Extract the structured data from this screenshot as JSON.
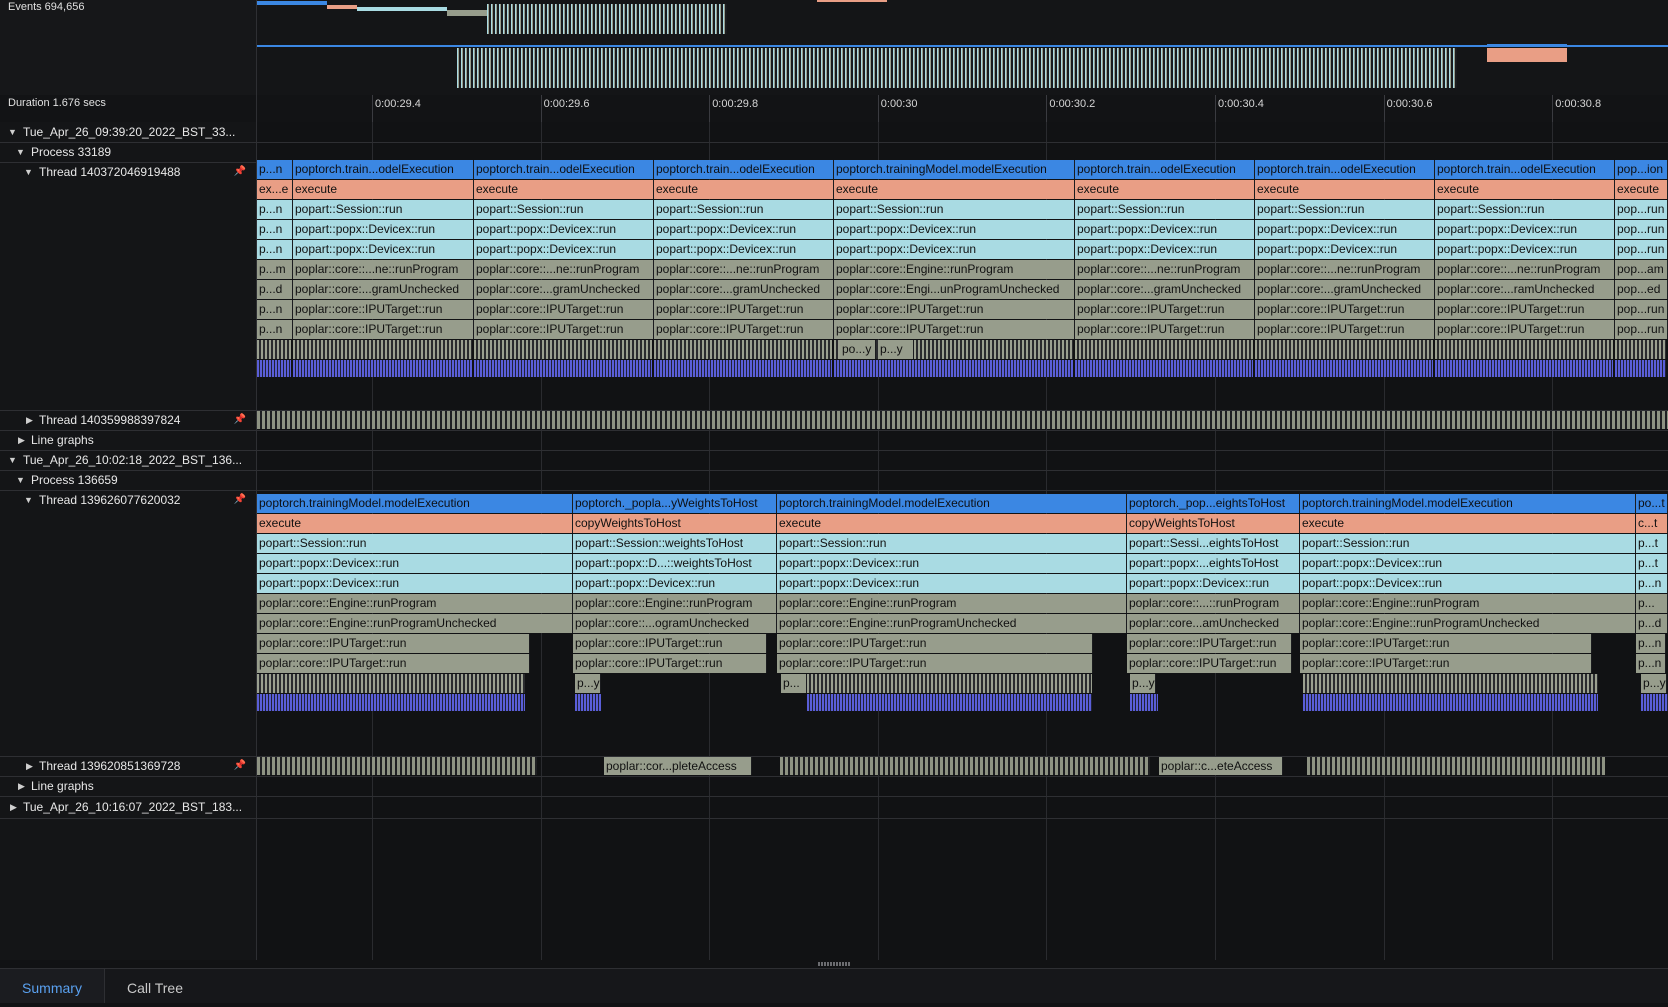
{
  "overview": {
    "events_label": "Events 694,656",
    "duration_label": "Duration 1.676 secs"
  },
  "ruler": {
    "ticks": [
      "0:00:29.4",
      "0:00:29.6",
      "0:00:29.8",
      "0:00:30",
      "0:00:30.2",
      "0:00:30.4",
      "0:00:30.6",
      "0:00:30.8"
    ]
  },
  "tree": {
    "session1": "Tue_Apr_26_09:39:20_2022_BST_33...",
    "process1": "Process 33189",
    "thread1": "Thread 140372046919488",
    "thread2": "Thread 140359988397824",
    "linegraphs1": "Line graphs",
    "session2": "Tue_Apr_26_10:02:18_2022_BST_136...",
    "process2": "Process 136659",
    "thread3": "Thread 139626077620032",
    "thread4": "Thread 139620851369728",
    "linegraphs2": "Line graphs",
    "session3": "Tue_Apr_26_10:16:07_2022_BST_183..."
  },
  "icons": {
    "expanded": "▼",
    "collapsed": "▶",
    "pin": "📌"
  },
  "colors": {
    "model_execution": "#3b87e3",
    "execute": "#e99e85",
    "popart": "#a9dbe3",
    "poplar": "#979d8c",
    "accent_tab": "#5aa1f0"
  },
  "tracks": {
    "t1": {
      "row0": [
        "p...n",
        "poptorch.train...odelExecution",
        "poptorch.train...odelExecution",
        "poptorch.train...odelExecution",
        "poptorch.trainingModel.modelExecution",
        "poptorch.train...odelExecution",
        "poptorch.train...odelExecution",
        "poptorch.train...odelExecution",
        "pop...ion"
      ],
      "row1": [
        "ex...e",
        "execute",
        "execute",
        "execute",
        "execute",
        "execute",
        "execute",
        "execute",
        "execute"
      ],
      "row2": [
        "p...n",
        "popart::Session::run",
        "popart::Session::run",
        "popart::Session::run",
        "popart::Session::run",
        "popart::Session::run",
        "popart::Session::run",
        "popart::Session::run",
        "pop...run"
      ],
      "row3": [
        "p...n",
        "popart::popx::Devicex::run",
        "popart::popx::Devicex::run",
        "popart::popx::Devicex::run",
        "popart::popx::Devicex::run",
        "popart::popx::Devicex::run",
        "popart::popx::Devicex::run",
        "popart::popx::Devicex::run",
        "pop...run"
      ],
      "row4": [
        "p...n",
        "popart::popx::Devicex::run",
        "popart::popx::Devicex::run",
        "popart::popx::Devicex::run",
        "popart::popx::Devicex::run",
        "popart::popx::Devicex::run",
        "popart::popx::Devicex::run",
        "popart::popx::Devicex::run",
        "pop...run"
      ],
      "row5": [
        "p...m",
        "poplar::core::...ne::runProgram",
        "poplar::core::...ne::runProgram",
        "poplar::core::...ne::runProgram",
        "poplar::core::Engine::runProgram",
        "poplar::core::...ne::runProgram",
        "poplar::core::...ne::runProgram",
        "poplar::core::...ne::runProgram",
        "pop...am"
      ],
      "row6": [
        "p...d",
        "poplar::core:...gramUnchecked",
        "poplar::core:...gramUnchecked",
        "poplar::core:...gramUnchecked",
        "poplar::core::Engi...unProgramUnchecked",
        "poplar::core:...gramUnchecked",
        "poplar::core:...gramUnchecked",
        "poplar::core:...ramUnchecked",
        "pop...ed"
      ],
      "row7": [
        "p...n",
        "poplar::core::IPUTarget::run",
        "poplar::core::IPUTarget::run",
        "poplar::core::IPUTarget::run",
        "poplar::core::IPUTarget::run",
        "poplar::core::IPUTarget::run",
        "poplar::core::IPUTarget::run",
        "poplar::core::IPUTarget::run",
        "pop...run"
      ],
      "row8": [
        "p...n",
        "poplar::core::IPUTarget::run",
        "poplar::core::IPUTarget::run",
        "poplar::core::IPUTarget::run",
        "poplar::core::IPUTarget::run",
        "poplar::core::IPUTarget::run",
        "poplar::core::IPUTarget::run",
        "poplar::core::IPUTarget::run",
        "pop...run"
      ],
      "small": [
        "po...y",
        "p...y"
      ]
    },
    "t3": {
      "row0": [
        "poptorch.trainingModel.modelExecution",
        "poptorch._popla...yWeightsToHost",
        "poptorch.trainingModel.modelExecution",
        "poptorch._pop...eightsToHost",
        "poptorch.trainingModel.modelExecution",
        "po...t"
      ],
      "row1": [
        "execute",
        "copyWeightsToHost",
        "execute",
        "copyWeightsToHost",
        "execute",
        "c...t"
      ],
      "row2": [
        "popart::Session::run",
        "popart::Session::weightsToHost",
        "popart::Session::run",
        "popart::Sessi...eightsToHost",
        "popart::Session::run",
        "p...t"
      ],
      "row3": [
        "popart::popx::Devicex::run",
        "popart::popx::D...::weightsToHost",
        "popart::popx::Devicex::run",
        "popart::popx:...eightsToHost",
        "popart::popx::Devicex::run",
        "p...t"
      ],
      "row4": [
        "popart::popx::Devicex::run",
        "popart::popx::Devicex::run",
        "popart::popx::Devicex::run",
        "popart::popx::Devicex::run",
        "popart::popx::Devicex::run",
        "p...n"
      ],
      "row5": [
        "poplar::core::Engine::runProgram",
        "poplar::core::Engine::runProgram",
        "poplar::core::Engine::runProgram",
        "poplar::core::...::runProgram",
        "poplar::core::Engine::runProgram",
        "p..."
      ],
      "row6": [
        "poplar::core::Engine::runProgramUnchecked",
        "poplar::core::...ogramUnchecked",
        "poplar::core::Engine::runProgramUnchecked",
        "poplar::core...amUnchecked",
        "poplar::core::Engine::runProgramUnchecked",
        "p...d"
      ],
      "row7": [
        "poplar::core::IPUTarget::run",
        "poplar::core::IPUTarget::run",
        "poplar::core::IPUTarget::run",
        "poplar::core::IPUTarget::run",
        "poplar::core::IPUTarget::run",
        "p...n"
      ],
      "row8": [
        "poplar::core::IPUTarget::run",
        "poplar::core::IPUTarget::run",
        "poplar::core::IPUTarget::run",
        "poplar::core::IPUTarget::run",
        "poplar::core::IPUTarget::run",
        "p...n"
      ],
      "small": [
        "p...y",
        "p...",
        "p...y",
        "p...y"
      ]
    },
    "t4": {
      "slices": [
        "poplar::cor...pleteAccess",
        "poplar::c...eteAccess"
      ]
    }
  },
  "bottom": {
    "tab_summary": "Summary",
    "tab_calltree": "Call Tree"
  }
}
